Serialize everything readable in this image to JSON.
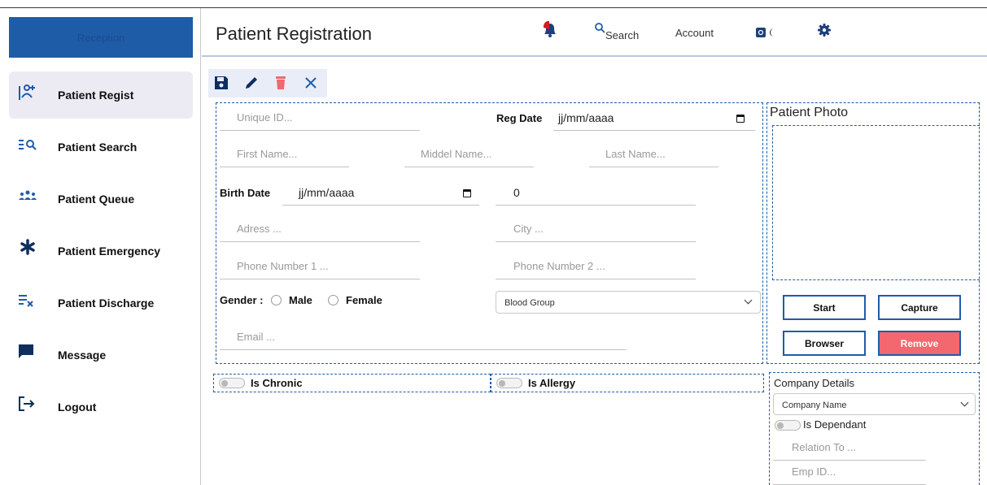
{
  "sidebar": {
    "brand": "Reception",
    "items": [
      {
        "label": "Patient Regist",
        "icon": "add-user-icon",
        "active": true
      },
      {
        "label": "Patient Search",
        "icon": "search-list-icon",
        "active": false
      },
      {
        "label": "Patient Queue",
        "icon": "group-icon",
        "active": false
      },
      {
        "label": "Patient Emergency",
        "icon": "asterisk-icon",
        "active": false
      },
      {
        "label": "Patient Discharge",
        "icon": "list-remove-icon",
        "active": false
      },
      {
        "label": "Message",
        "icon": "chat-icon",
        "active": false
      },
      {
        "label": "Logout",
        "icon": "logout-icon",
        "active": false
      }
    ]
  },
  "header": {
    "title": "Patient Registration",
    "search_label": "Search",
    "account_label": "Account",
    "notification_icon": "bell-icon",
    "settings_icon": "gear-icon",
    "theme_icon": "theme-toggle-icon"
  },
  "toolbar": {
    "save_icon": "save-icon",
    "edit_icon": "pencil-icon",
    "delete_icon": "trash-icon",
    "close_icon": "close-icon"
  },
  "form": {
    "unique_id_placeholder": "Unique ID...",
    "reg_date_label": "Reg Date",
    "reg_date_value": "jj/mm/aaaa",
    "first_name_placeholder": "First Name...",
    "middle_name_placeholder": "Middel Name...",
    "last_name_placeholder": "Last Name...",
    "birth_date_label": "Birth Date",
    "birth_date_value": "jj/mm/aaaa",
    "age_value": "0",
    "address_placeholder": "Adress ...",
    "city_placeholder": "City ...",
    "phone1_placeholder": "Phone Number 1 ...",
    "phone2_placeholder": "Phone Number 2 ...",
    "gender_label": "Gender :",
    "gender_male": "Male",
    "gender_female": "Female",
    "blood_group_value": "Blood Group",
    "email_placeholder": "Email ..."
  },
  "toggles": {
    "chronic_label": "Is Chronic",
    "allergy_label": "Is Allergy"
  },
  "photo": {
    "title": "Patient Photo",
    "start_label": "Start",
    "capture_label": "Capture",
    "browser_label": "Browser",
    "remove_label": "Remove"
  },
  "company": {
    "title": "Company Details",
    "company_name_value": "Company Name",
    "dependant_label": "Is Dependant",
    "relation_placeholder": "Relation To ...",
    "emp_id_placeholder": "Emp ID..."
  },
  "colors": {
    "primary": "#1f5ca8",
    "danger": "#f2686e",
    "active_nav_bg": "#ecebf4",
    "toolbar_bg": "#e9edf8"
  }
}
